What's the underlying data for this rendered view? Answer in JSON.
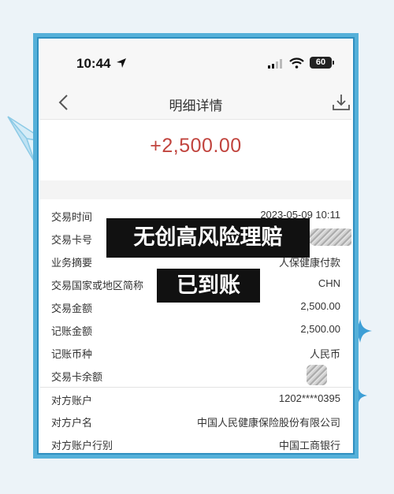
{
  "status_bar": {
    "time": "10:44",
    "battery": "60"
  },
  "nav": {
    "title": "明细详情"
  },
  "amount": "+2,500.00",
  "details": [
    {
      "label": "交易时间",
      "value": "2023-05-09 10:11"
    },
    {
      "label": "交易卡号",
      "value": ""
    },
    {
      "label": "业务摘要",
      "value": "人保健康付款"
    },
    {
      "label": "交易国家或地区简称",
      "value": "CHN"
    },
    {
      "label": "交易金额",
      "value": "2,500.00"
    },
    {
      "label": "记账金额",
      "value": "2,500.00"
    },
    {
      "label": "记账币种",
      "value": "人民币"
    },
    {
      "label": "交易卡余额",
      "value": ""
    },
    {
      "label": "对方账户",
      "value": "1202****0395"
    },
    {
      "label": "对方户名",
      "value": "中国人民健康保险股份有限公司"
    },
    {
      "label": "对方账户行别",
      "value": "中国工商银行"
    }
  ],
  "overlay": {
    "line1": "无创高风险理赔",
    "line2": "已到账"
  },
  "colors": {
    "amount": "#c1443e",
    "frame": "#55b0d9",
    "banner_bg": "#111111"
  },
  "icons": [
    "location-arrow-icon",
    "signal-icon",
    "wifi-icon",
    "battery-icon",
    "back-chevron-icon",
    "download-icon",
    "paper-plane-icon",
    "sparkle-icon"
  ]
}
